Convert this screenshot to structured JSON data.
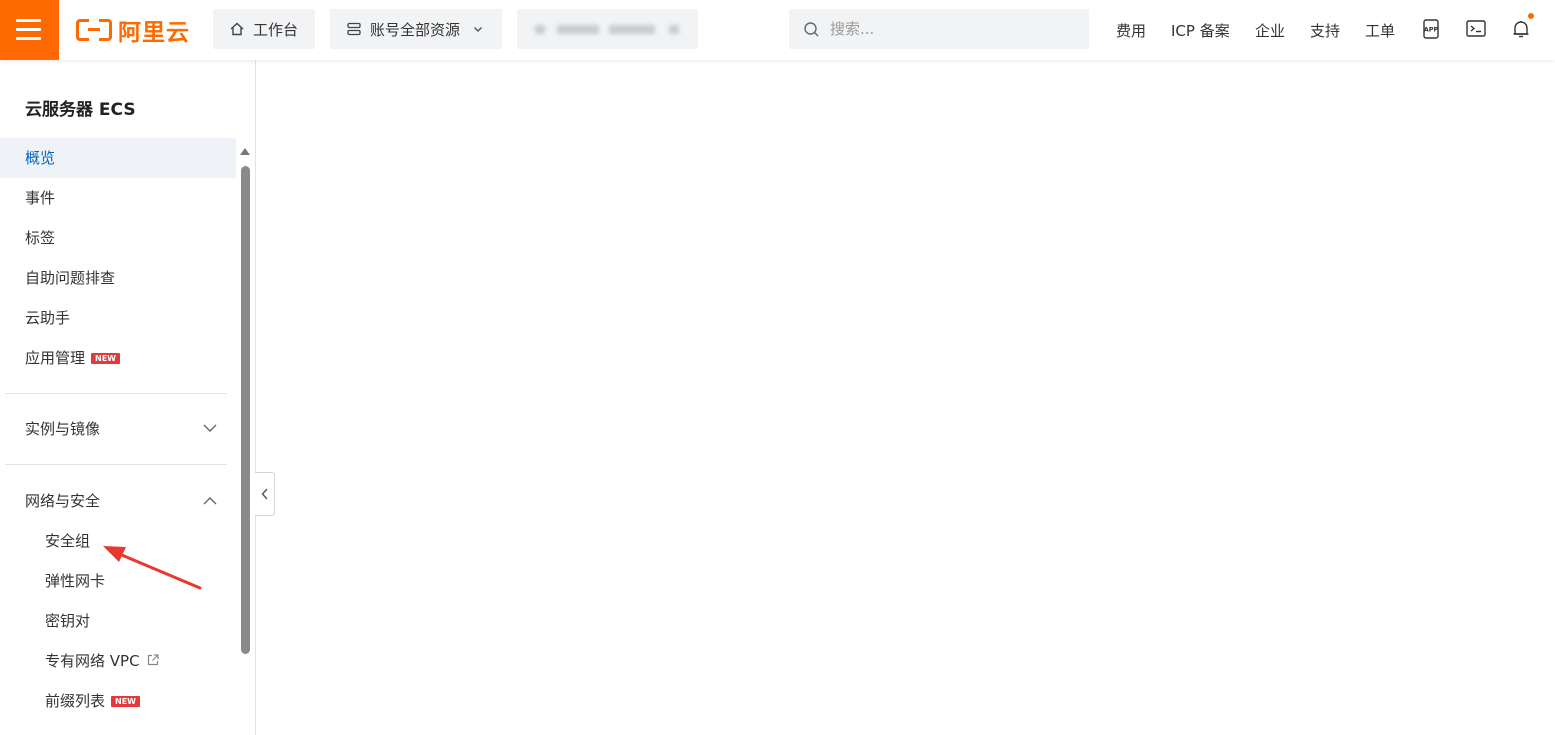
{
  "header": {
    "logo_text": "阿里云",
    "workbench_label": "工作台",
    "resource_label": "账号全部资源",
    "search_placeholder": "搜索...",
    "links": [
      "费用",
      "ICP 备案",
      "企业",
      "支持",
      "工单"
    ],
    "brand_color": "#ff6a00",
    "notification_dot_color": "#ff6a00"
  },
  "sidebar": {
    "title": "云服务器 ECS",
    "top_items": [
      {
        "label": "概览",
        "active": true
      },
      {
        "label": "事件"
      },
      {
        "label": "标签"
      },
      {
        "label": "自助问题排查"
      },
      {
        "label": "云助手"
      },
      {
        "label": "应用管理",
        "badge": "NEW"
      }
    ],
    "groups": [
      {
        "label": "实例与镜像",
        "expanded": false
      },
      {
        "label": "网络与安全",
        "expanded": true,
        "items": [
          {
            "label": "安全组"
          },
          {
            "label": "弹性网卡"
          },
          {
            "label": "密钥对"
          },
          {
            "label": "专有网络 VPC",
            "external": true
          },
          {
            "label": "前缀列表",
            "badge": "NEW"
          }
        ]
      }
    ],
    "active_color": "#0064c8",
    "badge_color": "#e4393c"
  },
  "annotation": {
    "arrow_color": "#e8392f"
  }
}
